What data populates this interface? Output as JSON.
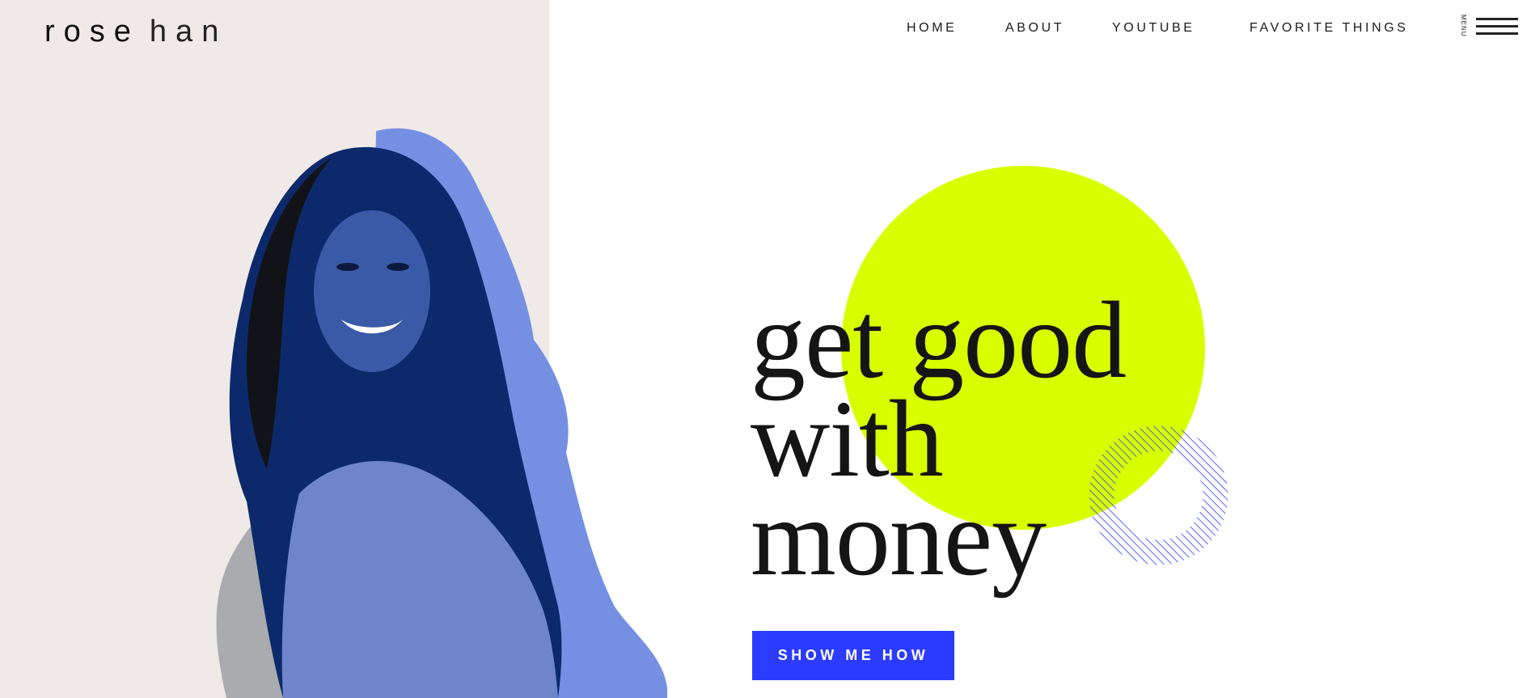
{
  "brand": {
    "first": "rose",
    "last": "han"
  },
  "nav": {
    "items": [
      "HOME",
      "ABOUT",
      "YOUTUBE",
      "FAVORITE THINGS"
    ],
    "menu_label": "MENU"
  },
  "hero": {
    "headline_lines": [
      "get good",
      "with",
      "money"
    ],
    "cta_label": "SHOW ME HOW"
  },
  "colors": {
    "left_panel": "#efe9e8",
    "accent_lime": "#d8ff00",
    "accent_blue": "#2b3bff",
    "photo_blob": "#7590e3",
    "photo_tint": "#0c2a6b",
    "text": "#151515"
  },
  "icons": {
    "menu": "hamburger-icon",
    "ring": "striped-ring-decoration"
  }
}
